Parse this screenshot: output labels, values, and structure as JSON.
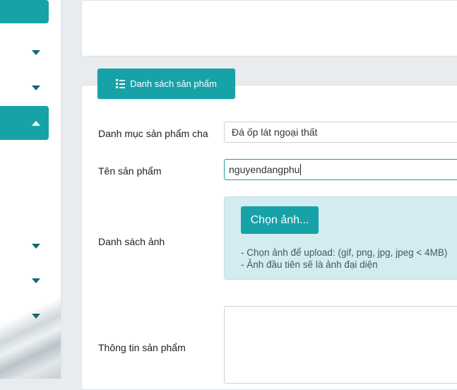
{
  "sidebar": {
    "accent_color": "#17a2a8"
  },
  "tab": {
    "label": "Danh sách sản phẩm",
    "icon": "list-icon"
  },
  "form": {
    "category_label": "Danh mục sản phẩm cha",
    "category_value": "Đá ốp lát ngoại thất",
    "name_label": "Tên sản phẩm",
    "name_value": "nguyendangphu",
    "images_label": "Danh sách ảnh",
    "choose_button": "Chọn ảnh...",
    "hint_1": "- Chọn ảnh để upload: (gif, png, jpg, jpeg < 4MB)",
    "hint_2": "- Ảnh đầu tiên sẽ là ảnh đại diện",
    "info_label": "Thông tin sản phẩm"
  }
}
